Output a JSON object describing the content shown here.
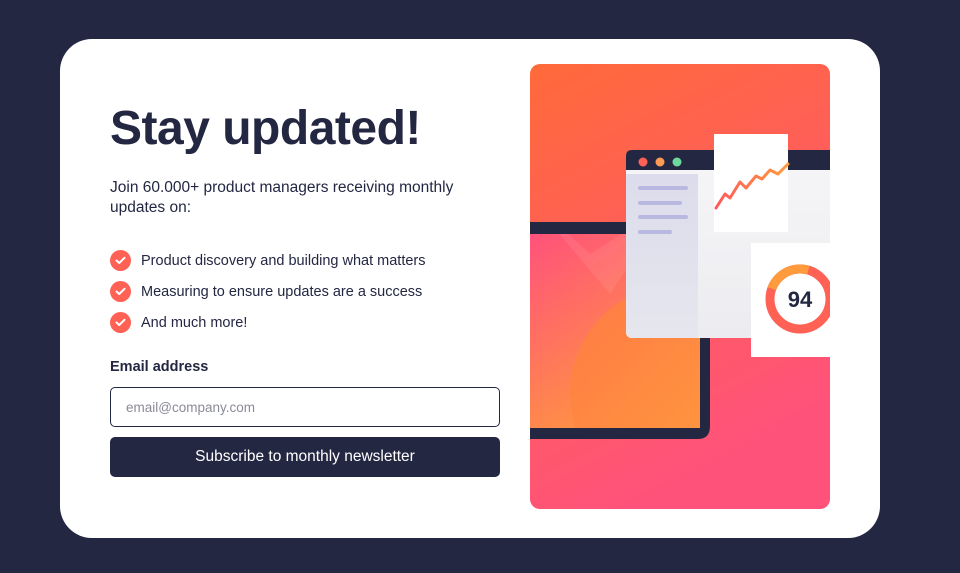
{
  "signup": {
    "title": "Stay updated!",
    "intro": "Join 60.000+ product managers receiving monthly updates on:",
    "features": [
      "Product discovery and building what matters",
      "Measuring to ensure updates are a success",
      "And much more!"
    ],
    "email_label": "Email address",
    "email_placeholder": "email@company.com",
    "email_value": "",
    "submit_label": "Subscribe to monthly newsletter"
  },
  "illustration": {
    "score": "94",
    "icon": "dashboard-illustration"
  },
  "colors": {
    "page_background": "#242742",
    "card_background": "#ffffff",
    "text_dark": "#242742",
    "accent": "#ff6155",
    "gradient_top": "#ff6a3a",
    "gradient_bottom": "#ff527b"
  }
}
